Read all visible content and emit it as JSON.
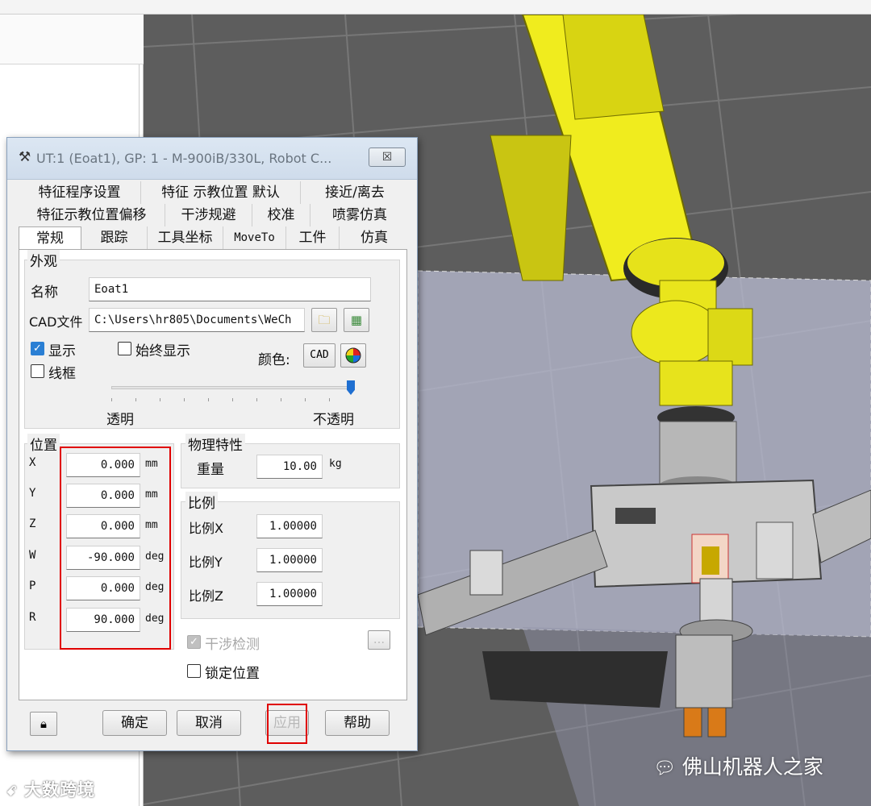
{
  "dialog": {
    "title": "UT:1  (Eoat1), GP: 1 - M-900iB/330L, Robot C...",
    "close_glyph": "☒",
    "tabs_row1": [
      "特征程序设置",
      "特征 示教位置 默认",
      "接近/离去"
    ],
    "tabs_row2": [
      "特征示教位置偏移",
      "干涉规避",
      "校准",
      "喷雾仿真"
    ],
    "tabs_row3": [
      "常规",
      "跟踪",
      "工具坐标",
      "MoveTo",
      "工件",
      "仿真"
    ],
    "appearance": {
      "group_label": "外观",
      "name_label": "名称",
      "name_value": "Eoat1",
      "cad_label": "CAD文件",
      "cad_value": "C:\\Users\\hr805\\Documents\\WeCh",
      "show_label": "显示",
      "show_checked": true,
      "always_show_label": "始终显示",
      "always_show_checked": false,
      "wireframe_label": "线框",
      "wireframe_checked": false,
      "color_label": "颜色:",
      "cad_color_button": "CAD",
      "transparent_label": "透明",
      "opaque_label": "不透明",
      "opacity_level": 1.0
    },
    "position": {
      "group_label": "位置",
      "rows": [
        {
          "axis": "X",
          "value": "0.000",
          "unit": "mm"
        },
        {
          "axis": "Y",
          "value": "0.000",
          "unit": "mm"
        },
        {
          "axis": "Z",
          "value": "0.000",
          "unit": "mm"
        },
        {
          "axis": "W",
          "value": "-90.000",
          "unit": "deg"
        },
        {
          "axis": "P",
          "value": "0.000",
          "unit": "deg"
        },
        {
          "axis": "R",
          "value": "90.000",
          "unit": "deg"
        }
      ]
    },
    "physics": {
      "group_label": "物理特性",
      "weight_label": "重量",
      "weight_value": "10.00",
      "weight_unit": "kg"
    },
    "scale": {
      "group_label": "比例",
      "rows": [
        {
          "label": "比例X",
          "value": "1.00000"
        },
        {
          "label": "比例Y",
          "value": "1.00000"
        },
        {
          "label": "比例Z",
          "value": "1.00000"
        }
      ]
    },
    "interference_label": "干涉检测",
    "interference_checked": true,
    "ellipsis_button": "...",
    "lock_position_label": "锁定位置",
    "lock_position_checked": false,
    "buttons": {
      "ok": "确定",
      "cancel": "取消",
      "apply": "应用",
      "help": "帮助"
    }
  },
  "watermarks": {
    "right": "佛山机器人之家",
    "left": "大数跨境"
  },
  "colors": {
    "robot_yellow": "#f2ee1c",
    "highlight_red": "#e00000",
    "checkbox_blue": "#2a7fd4"
  }
}
